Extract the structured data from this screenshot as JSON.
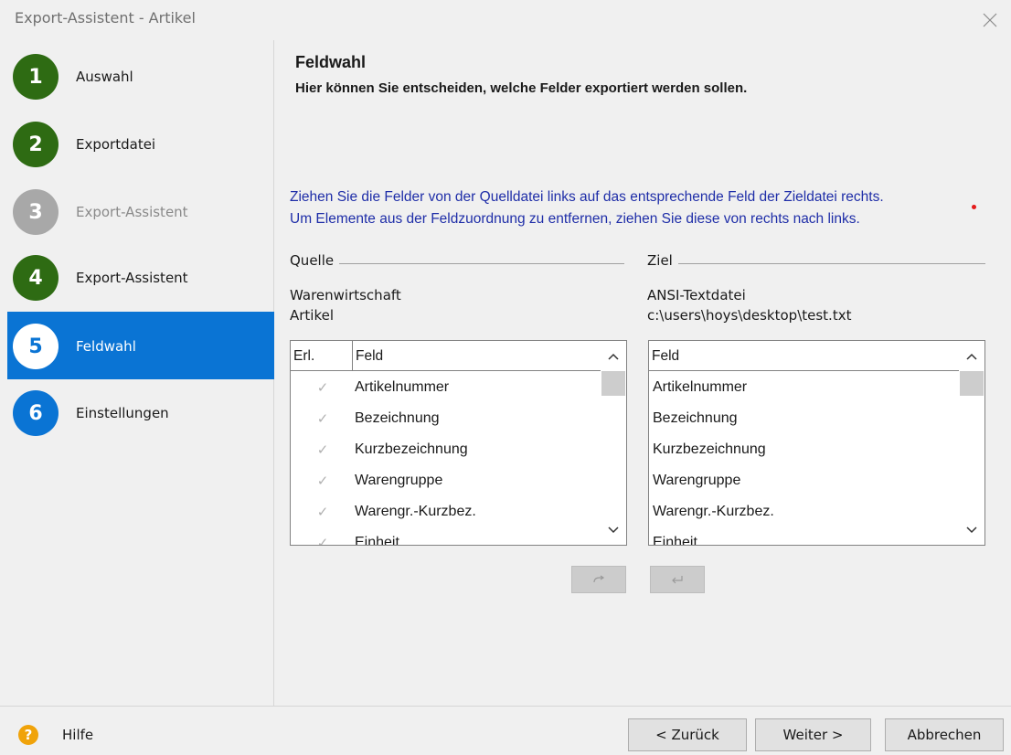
{
  "window": {
    "title": "Export-Assistent - Artikel",
    "close_icon": "close-icon"
  },
  "colors": {
    "accent": "#0a74d4",
    "done": "#2e6b13",
    "disabled": "#a8a8a8",
    "instruction_text": "#1f2ea8",
    "help_icon": "#f0a30a"
  },
  "steps": [
    {
      "number": "1",
      "label": "Auswahl",
      "state": "done"
    },
    {
      "number": "2",
      "label": "Exportdatei",
      "state": "done"
    },
    {
      "number": "3",
      "label": "Export-Assistent",
      "state": "disabled"
    },
    {
      "number": "4",
      "label": "Export-Assistent",
      "state": "done"
    },
    {
      "number": "5",
      "label": "Feldwahl",
      "state": "current"
    },
    {
      "number": "6",
      "label": "Einstellungen",
      "state": "todo"
    }
  ],
  "main": {
    "title": "Feldwahl",
    "subtitle": "Hier können Sie entscheiden, welche Felder exportiert werden sollen.",
    "instruction_line1": "Ziehen Sie die Felder von der Quelldatei links auf das entsprechende Feld der Zieldatei rechts.",
    "instruction_line2": "Um Elemente aus der Feldzuordnung zu entfernen, ziehen Sie diese von rechts nach links."
  },
  "source": {
    "heading": "Quelle",
    "line1": "Warenwirtschaft",
    "line2": "Artikel",
    "columns": [
      "Erl.",
      "Feld"
    ],
    "rows": [
      "Artikelnummer",
      "Bezeichnung",
      "Kurzbezeichnung",
      "Warengruppe",
      "Warengr.-Kurzbez.",
      "Einheit"
    ]
  },
  "target": {
    "heading": "Ziel",
    "line1": "ANSI-Textdatei",
    "line2": "c:\\users\\hoys\\desktop\\test.txt",
    "columns": [
      "Feld"
    ],
    "rows": [
      "Artikelnummer",
      "Bezeichnung",
      "Kurzbezeichnung",
      "Warengruppe",
      "Warengr.-Kurzbez.",
      "Einheit"
    ]
  },
  "footer": {
    "help_label": "Hilfe",
    "back_label": "< Zurück",
    "next_label": "Weiter >",
    "cancel_label": "Abbrechen"
  }
}
